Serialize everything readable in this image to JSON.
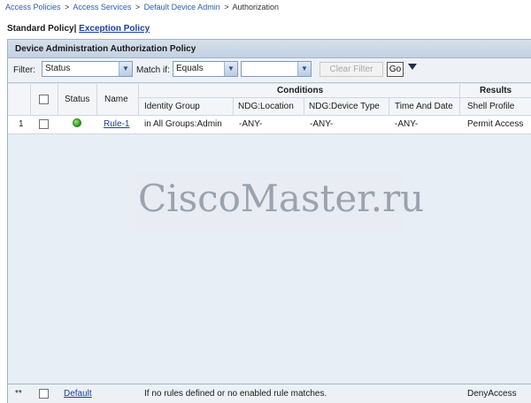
{
  "breadcrumb": {
    "items": [
      "Access Policies",
      "Access Services",
      "Default Device Admin",
      "Authorization"
    ],
    "separator": ">"
  },
  "tabs": {
    "standard": "Standard Policy",
    "divider": "|",
    "exception": "Exception Policy"
  },
  "panel": {
    "title": "Device Administration Authorization Policy"
  },
  "filter": {
    "label": "Filter:",
    "field_value": "Status",
    "match_label": "Match if:",
    "operator_value": "Equals",
    "value_value": "",
    "clear_button": "Clear Filter",
    "go_button": "Go"
  },
  "table": {
    "headers": {
      "status": "Status",
      "name": "Name",
      "conditions": "Conditions",
      "results": "Results",
      "identity_group": "Identity Group",
      "ndg_location": "NDG:Location",
      "ndg_device_type": "NDG:Device Type",
      "time_and_date": "Time And Date",
      "shell_profile": "Shell Profile"
    },
    "rows": [
      {
        "num": "1",
        "status": "enabled",
        "name": "Rule-1",
        "identity_group": "in All Groups:Admin",
        "ndg_location": "-ANY-",
        "ndg_device_type": "-ANY-",
        "time_and_date": "-ANY-",
        "shell_profile": "Permit Access"
      }
    ],
    "default_row": {
      "num": "**",
      "name": "Default",
      "description": "If no rules defined or no enabled rule matches.",
      "shell_profile": "DenyAccess"
    }
  },
  "watermark": "CiscoMaster.ru",
  "colors": {
    "link": "#1a3f9e",
    "panel_bg": "#dde6f0",
    "status_enabled": "#2f9b22"
  }
}
